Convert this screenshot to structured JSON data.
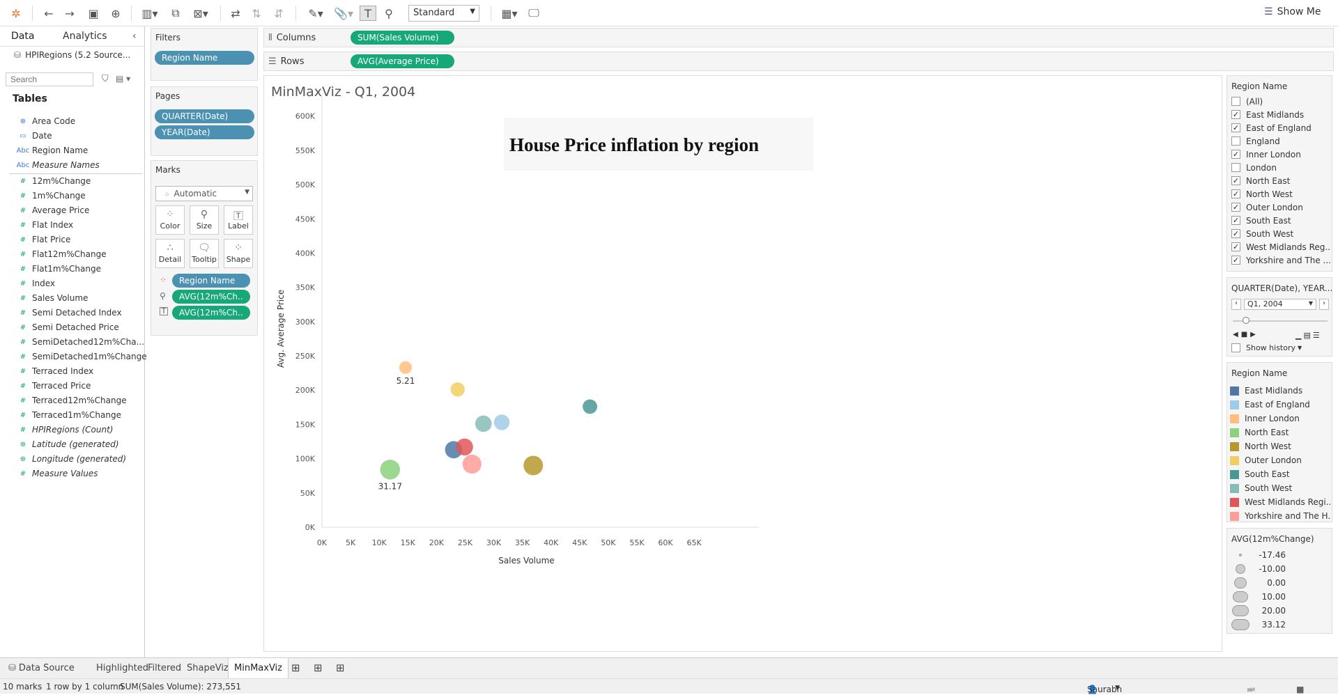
{
  "toolbar": {
    "marktype_label": "Standard",
    "showme_label": "Show Me"
  },
  "left": {
    "tab_data": "Data",
    "tab_analytics": "Analytics",
    "datasource": "HPIRegions (5.2 Source...",
    "search_placeholder": "Search",
    "tables_heading": "Tables",
    "fields": [
      {
        "type": "geo",
        "name": "Area Code",
        "italic": false
      },
      {
        "type": "date",
        "name": "Date",
        "italic": false
      },
      {
        "type": "abc",
        "name": "Region Name",
        "italic": false
      },
      {
        "type": "abc",
        "name": "Measure Names",
        "italic": true
      },
      {
        "type": "num",
        "name": "12m%Change",
        "italic": false
      },
      {
        "type": "num",
        "name": "1m%Change",
        "italic": false
      },
      {
        "type": "num",
        "name": "Average Price",
        "italic": false
      },
      {
        "type": "num",
        "name": "Flat Index",
        "italic": false
      },
      {
        "type": "num",
        "name": "Flat Price",
        "italic": false
      },
      {
        "type": "num",
        "name": "Flat12m%Change",
        "italic": false
      },
      {
        "type": "num",
        "name": "Flat1m%Change",
        "italic": false
      },
      {
        "type": "num",
        "name": "Index",
        "italic": false
      },
      {
        "type": "num",
        "name": "Sales Volume",
        "italic": false
      },
      {
        "type": "num",
        "name": "Semi Detached Index",
        "italic": false
      },
      {
        "type": "num",
        "name": "Semi Detached Price",
        "italic": false
      },
      {
        "type": "num",
        "name": "SemiDetached12m%Cha...",
        "italic": false
      },
      {
        "type": "num",
        "name": "SemiDetached1m%Change",
        "italic": false
      },
      {
        "type": "num",
        "name": "Terraced Index",
        "italic": false
      },
      {
        "type": "num",
        "name": "Terraced Price",
        "italic": false
      },
      {
        "type": "num",
        "name": "Terraced12m%Change",
        "italic": false
      },
      {
        "type": "num",
        "name": "Terraced1m%Change",
        "italic": false
      },
      {
        "type": "num",
        "name": "HPIRegions (Count)",
        "italic": true
      },
      {
        "type": "geo",
        "name": "Latitude (generated)",
        "italic": true
      },
      {
        "type": "geo",
        "name": "Longitude (generated)",
        "italic": true
      },
      {
        "type": "num",
        "name": "Measure Values",
        "italic": true
      }
    ]
  },
  "filters": {
    "title": "Filters",
    "pill": "Region Name"
  },
  "pages": {
    "title": "Pages",
    "pills": [
      "QUARTER(Date)",
      "YEAR(Date)"
    ]
  },
  "marks": {
    "title": "Marks",
    "type": "Automatic",
    "buttons": [
      "Color",
      "Size",
      "Label",
      "Detail",
      "Tooltip",
      "Shape"
    ],
    "pills": [
      "Region Name",
      "AVG(12m%Ch..",
      "AVG(12m%Ch.."
    ]
  },
  "shelves": {
    "columns_label": "Columns",
    "columns_pill": "SUM(Sales Volume)",
    "rows_label": "Rows",
    "rows_pill": "AVG(Average Price)"
  },
  "viz": {
    "sheet_title": "MinMaxViz - Q1, 2004",
    "annotation": "House Price inflation by region"
  },
  "chart_data": {
    "type": "scatter",
    "xlabel": "Sales Volume",
    "ylabel": "Avg. Average Price",
    "xlim": [
      0,
      69000
    ],
    "ylim": [
      0,
      620000
    ],
    "xticks": [
      "0K",
      "5K",
      "10K",
      "15K",
      "20K",
      "25K",
      "30K",
      "35K",
      "40K",
      "45K",
      "50K",
      "55K",
      "60K",
      "65K"
    ],
    "yticks": [
      "0K",
      "50K",
      "100K",
      "150K",
      "200K",
      "250K",
      "300K",
      "350K",
      "400K",
      "450K",
      "500K",
      "550K",
      "600K"
    ],
    "points": [
      {
        "region": "Inner London",
        "x": 14600,
        "y": 233000,
        "size": 5.21,
        "color": "#ffbe7d",
        "label": "5.21"
      },
      {
        "region": "Outer London",
        "x": 23700,
        "y": 201000,
        "size": 11,
        "color": "#f1ce63",
        "label": ""
      },
      {
        "region": "South East",
        "x": 46800,
        "y": 176000,
        "size": 12,
        "color": "#499894",
        "label": ""
      },
      {
        "region": "South West",
        "x": 28200,
        "y": 151000,
        "size": 19,
        "color": "#86bcb6",
        "label": ""
      },
      {
        "region": "East of England",
        "x": 31400,
        "y": 153000,
        "size": 16,
        "color": "#a0cbe8",
        "label": ""
      },
      {
        "region": "East Midlands",
        "x": 23000,
        "y": 113000,
        "size": 22,
        "color": "#4e79a7",
        "label": ""
      },
      {
        "region": "West Midlands Region",
        "x": 24900,
        "y": 117000,
        "size": 21,
        "color": "#e15759",
        "label": ""
      },
      {
        "region": "Yorkshire and The Humber",
        "x": 26200,
        "y": 92000,
        "size": 28,
        "color": "#ff9d9a",
        "label": ""
      },
      {
        "region": "North West",
        "x": 36900,
        "y": 90000,
        "size": 30,
        "color": "#b6992d",
        "label": ""
      },
      {
        "region": "North East",
        "x": 11900,
        "y": 84000,
        "size": 31.17,
        "color": "#8cd17d",
        "label": "31.17"
      }
    ]
  },
  "region_filter": {
    "title": "Region Name",
    "items": [
      {
        "label": "(All)",
        "checked": false
      },
      {
        "label": "East Midlands",
        "checked": true
      },
      {
        "label": "East of England",
        "checked": true
      },
      {
        "label": "England",
        "checked": false
      },
      {
        "label": "Inner London",
        "checked": true
      },
      {
        "label": "London",
        "checked": false
      },
      {
        "label": "North East",
        "checked": true
      },
      {
        "label": "North West",
        "checked": true
      },
      {
        "label": "Outer London",
        "checked": true
      },
      {
        "label": "South East",
        "checked": true
      },
      {
        "label": "South West",
        "checked": true
      },
      {
        "label": "West Midlands Reg...",
        "checked": true
      },
      {
        "label": "Yorkshire and The ...",
        "checked": true
      }
    ]
  },
  "page_control": {
    "title": "QUARTER(Date), YEAR...",
    "value": "Q1, 2004",
    "show_history": "Show history"
  },
  "color_legend": {
    "title": "Region Name",
    "items": [
      {
        "label": "East Midlands",
        "color": "#4e79a7"
      },
      {
        "label": "East of England",
        "color": "#a0cbe8"
      },
      {
        "label": "Inner London",
        "color": "#ffbe7d"
      },
      {
        "label": "North East",
        "color": "#8cd17d"
      },
      {
        "label": "North West",
        "color": "#b6992d"
      },
      {
        "label": "Outer London",
        "color": "#f1ce63"
      },
      {
        "label": "South East",
        "color": "#499894"
      },
      {
        "label": "South West",
        "color": "#86bcb6"
      },
      {
        "label": "West Midlands Regi...",
        "color": "#e15759"
      },
      {
        "label": "Yorkshire and The H...",
        "color": "#ff9d9a"
      }
    ]
  },
  "size_legend": {
    "title": "AVG(12m%Change)",
    "items": [
      "-17.46",
      "-10.00",
      "0.00",
      "10.00",
      "20.00",
      "33.12"
    ]
  },
  "sheet_tabs": {
    "datasource": "Data Source",
    "tabs": [
      "Highlighted",
      "Filtered",
      "ShapeViz",
      "MinMaxViz"
    ],
    "active": "MinMaxViz"
  },
  "status": {
    "marks": "10 marks",
    "dims": "1 row by 1 column",
    "sum": "SUM(Sales Volume): 273,551",
    "user": "Saurabh"
  }
}
